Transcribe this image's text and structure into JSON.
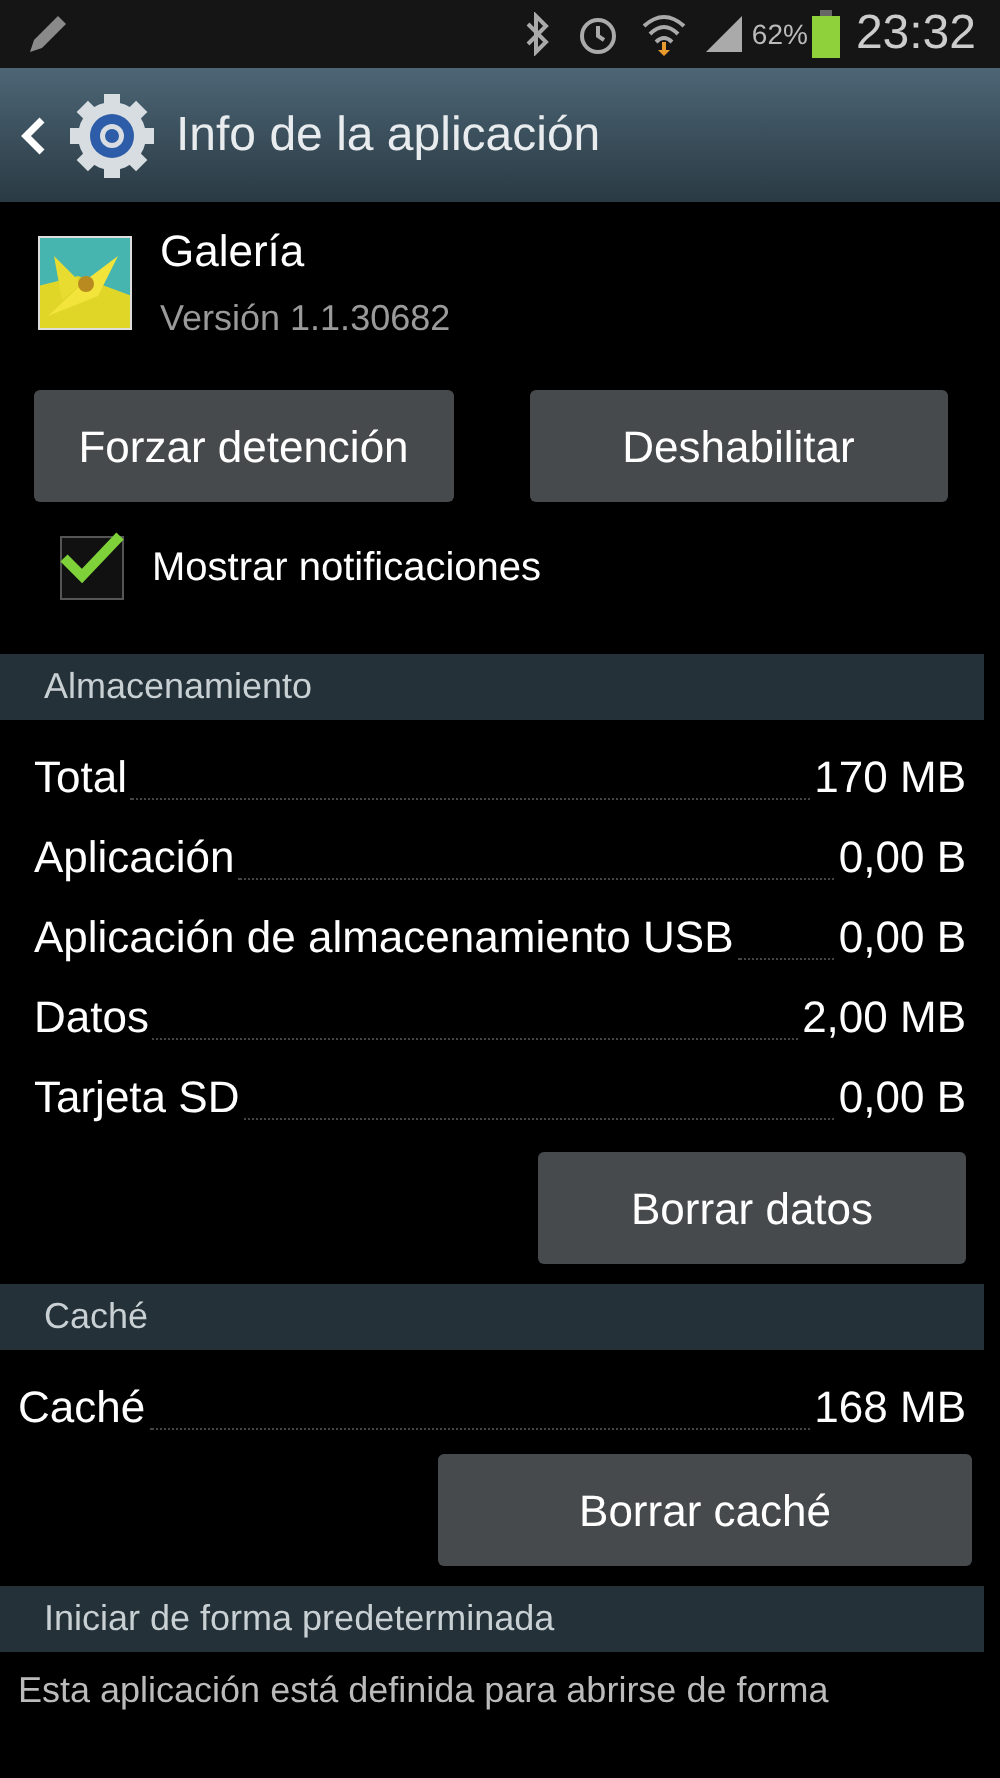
{
  "status_bar": {
    "battery": "62%",
    "time": "23:32"
  },
  "action_bar": {
    "title": "Info de la aplicación"
  },
  "app": {
    "name": "Galería",
    "version": "Versión 1.1.30682"
  },
  "buttons": [
    "Forzar detención",
    "Deshabilitar"
  ],
  "notifications": {
    "label": "Mostrar notificaciones",
    "checked": true
  },
  "sections": [
    {
      "title": "Almacenamiento",
      "rows": [
        {
          "label": "Total",
          "value": "170 MB"
        },
        {
          "label": "Aplicación",
          "value": "0,00 B"
        },
        {
          "label": "Aplicación de almacenamiento USB",
          "value": "0,00 B"
        },
        {
          "label": "Datos",
          "value": "2,00 MB"
        },
        {
          "label": "Tarjeta SD",
          "value": "0,00 B"
        }
      ],
      "button": "Borrar datos"
    },
    {
      "title": "Caché",
      "rows": [
        {
          "label": "Caché",
          "value": "168 MB"
        }
      ],
      "button": "Borrar caché"
    },
    {
      "title": "Iniciar de forma predeterminada",
      "text": "Esta aplicación está definida para abrirse de forma"
    }
  ]
}
